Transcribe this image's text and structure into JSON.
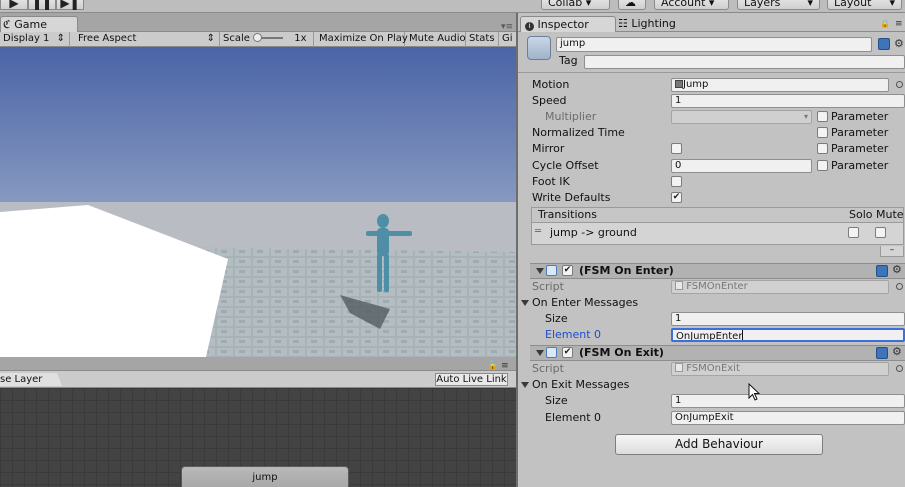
{
  "toolbar": {
    "play_icon": "play-icon",
    "pause_icon": "pause-icon",
    "step_icon": "step-icon",
    "collab_label": "Collab ▾",
    "account_label": "Account",
    "layers_label": "Layers",
    "layout_label": "Layout"
  },
  "game": {
    "tab_label": "Game",
    "display": "Display 1",
    "aspect": "Free Aspect",
    "scale_label": "Scale",
    "scale_value": "1x",
    "maximize_on_play": "Maximize On Play",
    "mute_audio": "Mute Audio",
    "stats": "Stats",
    "gizmos": "Gi"
  },
  "animator": {
    "layer_tab": "se Layer",
    "auto_live_link": "Auto Live Link",
    "node_label": "jump"
  },
  "inspector": {
    "tabs": [
      {
        "label": "Inspector",
        "icon": "info-icon"
      },
      {
        "label": "Lighting",
        "icon": "lighting-icon"
      }
    ],
    "state_name": "jump",
    "tag_label": "Tag",
    "tag_value": "",
    "properties": {
      "motion_label": "Motion",
      "motion_value": "Jump",
      "speed_label": "Speed",
      "speed_value": "1",
      "multiplier_label": "Multiplier",
      "multiplier_value": "",
      "normalized_time_label": "Normalized Time",
      "mirror_label": "Mirror",
      "mirror_checked": false,
      "cycle_offset_label": "Cycle Offset",
      "cycle_offset_value": "0",
      "foot_ik_label": "Foot IK",
      "foot_ik_checked": false,
      "write_defaults_label": "Write Defaults",
      "write_defaults_checked": true,
      "parameter_label": "Parameter"
    },
    "transitions": {
      "header": "Transitions",
      "solo_label": "Solo",
      "mute_label": "Mute",
      "items": [
        {
          "label": "jump -> ground",
          "solo": false,
          "mute": false
        }
      ]
    },
    "behaviours": [
      {
        "title": "(FSM On Enter)",
        "enabled": true,
        "script_label": "Script",
        "script_value": "FSMOnEnter",
        "messages_label": "On Enter Messages",
        "size_label": "Size",
        "size_value": "1",
        "element_label": "Element 0",
        "element_value": "OnJumpEnter"
      },
      {
        "title": "(FSM On Exit)",
        "enabled": true,
        "script_label": "Script",
        "script_value": "FSMOnExit",
        "messages_label": "On Exit Messages",
        "size_label": "Size",
        "size_value": "1",
        "element_label": "Element 0",
        "element_value": "OnJumpExit"
      }
    ],
    "add_behaviour_label": "Add Behaviour"
  },
  "colors": {
    "editor_bg": "#c2c2c2",
    "focus_blue": "#3d6fd9",
    "sky_top": "#4a64a6",
    "floor": "#a9b4b8",
    "character": "#4f8fa6"
  }
}
